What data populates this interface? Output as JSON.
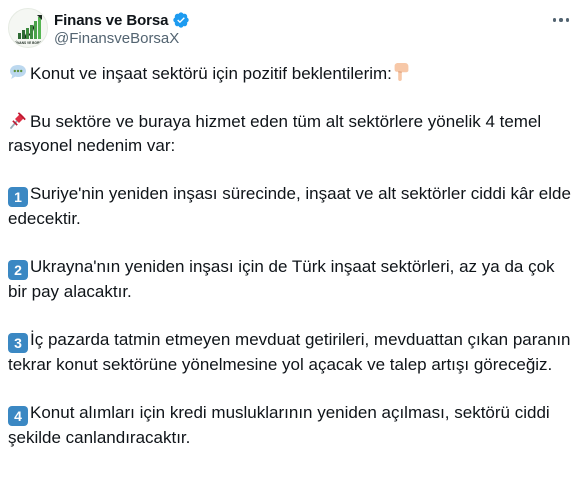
{
  "author": {
    "display_name": "Finans ve Borsa",
    "handle": "@FinansveBorsaX",
    "avatar_text": "FİNANS VE BORSA",
    "verified": true,
    "verified_color": "#1d9bf0"
  },
  "icons": {
    "speech_bubble": "speech-bubble-emoji",
    "pointing_down": "pointing-down-emoji",
    "pushpin": "pushpin-emoji",
    "more": "more-icon"
  },
  "tweet": {
    "line1": "Konut ve inşaat sektörü için pozitif beklentilerim:",
    "line2": "Bu sektöre ve buraya hizmet eden tüm alt sektörlere yönelik 4 temel rasyonel nedenim var:",
    "items": [
      {
        "num": "1",
        "text": "Suriye'nin yeniden inşası sürecinde, inşaat ve alt sektörler ciddi kâr elde edecektir."
      },
      {
        "num": "2",
        "text": "Ukrayna'nın yeniden inşası için de Türk inşaat sektörleri, az ya da çok bir pay alacaktır."
      },
      {
        "num": "3",
        "text": "İç pazarda tatmin etmeyen mevduat getirileri, mevduattan çıkan paranın tekrar konut sektörüne yönelmesine yol açacak ve talep artışı göreceğiz."
      },
      {
        "num": "4",
        "text": "Konut alımları için kredi musluklarının yeniden açılması, sektörü ciddi şekilde canlandıracaktır."
      }
    ],
    "keycap_color": "#3b88c3"
  }
}
